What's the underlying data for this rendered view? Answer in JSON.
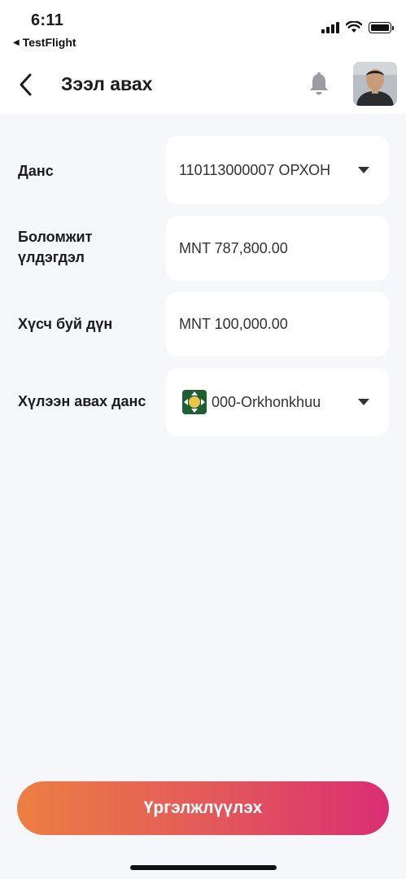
{
  "status_bar": {
    "time": "6:11",
    "back_app": "TestFlight",
    "back_arrow": "◀"
  },
  "header": {
    "title": "Зээл авах",
    "icons": [
      "back-arrow-icon",
      "bell-icon",
      "avatar"
    ]
  },
  "form": {
    "account": {
      "label": "Данс",
      "value": "110113000007 ОРХОН"
    },
    "available_balance": {
      "label_line1": "Боломжит",
      "label_line2": "үлдэгдэл",
      "value": "MNT 787,800.00"
    },
    "requested_amount": {
      "label": "Хүсч буй дүн",
      "value": "MNT 100,000.00"
    },
    "receiving_account": {
      "label": "Хүлээн авах данс",
      "value": "000-Orkhonkhuu"
    }
  },
  "cta": {
    "label": "Үргэлжлүүлэх"
  },
  "colors": {
    "background": "#f6f7fb",
    "card": "#ffffff",
    "gradient_start": "#ec7f43",
    "gradient_end": "#d92e73",
    "bank_logo": "#1f5e34"
  }
}
